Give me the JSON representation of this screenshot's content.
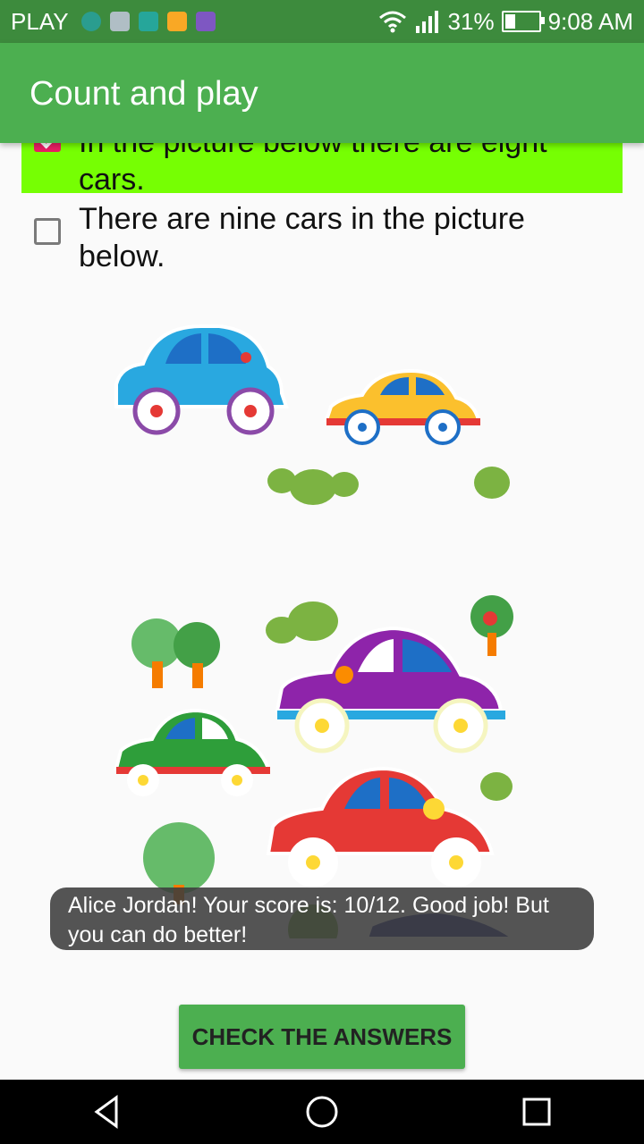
{
  "status_bar": {
    "carrier": "PLAY",
    "signal_percent": "31%",
    "time": "9:08 AM",
    "battery_level": 0.31
  },
  "app_bar": {
    "title": "Count and play"
  },
  "options": [
    {
      "text": "In the picture below there are eight cars.",
      "checked": true
    },
    {
      "text": "There are nine cars in the picture below.",
      "checked": false
    }
  ],
  "toast": {
    "message": "Alice Jordan! Your score is: 10/12. Good job! But you can do better!"
  },
  "check_button": {
    "label": "CHECK THE ANSWERS"
  },
  "colors": {
    "status_bar": "#3d8b3d",
    "app_bar": "#4caf50",
    "selected_option": "#76ff03",
    "checkbox_checked": "#e91e63"
  }
}
